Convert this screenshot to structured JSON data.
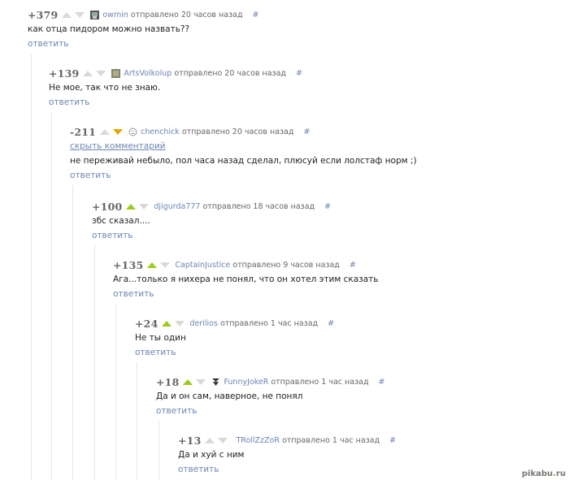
{
  "comments": [
    {
      "rating": "+379",
      "user": "owmin",
      "meta": "отправлено 20 часов назад",
      "hash": "#",
      "text": "как отца пидором можно назвать??",
      "reply": "ответить",
      "hide": ""
    },
    {
      "rating": "+139",
      "user": "ArtsVolkolup",
      "meta": "отправлено 20 часов назад",
      "hash": "#",
      "text": "Не мое, так что не знаю.",
      "reply": "ответить",
      "hide": ""
    },
    {
      "rating": "-211",
      "user": "chenchick",
      "meta": "отправлено 20 часов назад",
      "hash": "#",
      "text": "не переживай небыло, пол часа назад сделал, плюсуй если лолстаф норм ;)",
      "reply": "ответить",
      "hide": "скрыть комментарий"
    },
    {
      "rating": "+100",
      "user": "djigurda777",
      "meta": "отправлено 18 часов назад",
      "hash": "#",
      "text": "збс сказал....",
      "reply": "ответить",
      "hide": ""
    },
    {
      "rating": "+135",
      "user": "CaptainJustice",
      "meta": "отправлено 9 часов назад",
      "hash": "#",
      "text": "Ага...только я нихера не понял, что он хотел этим сказать",
      "reply": "ответить",
      "hide": ""
    },
    {
      "rating": "+24",
      "user": "derilios",
      "meta": "отправлено 1 час назад",
      "hash": "#",
      "text": "Не ты один",
      "reply": "ответить",
      "hide": ""
    },
    {
      "rating": "+18",
      "user": "FunnyJokeR",
      "meta": "отправлено 1 час назад",
      "hash": "#",
      "text": "Да и он сам, наверное, не понял",
      "reply": "ответить",
      "hide": ""
    },
    {
      "rating": "+13",
      "user": "TRollZzZoR",
      "meta": "отправлено 1 час назад",
      "hash": "#",
      "text": "Да и хуй с ним",
      "reply": "ответить",
      "hide": ""
    }
  ],
  "watermark": {
    "brand": "pikabu",
    "dot": ".",
    "tld": "ru"
  },
  "colors": {
    "link": "#6a86b3",
    "upvoted": "#9ccc18",
    "downvoted": "#e4a800",
    "arrow_idle": "#d9d9d9"
  }
}
